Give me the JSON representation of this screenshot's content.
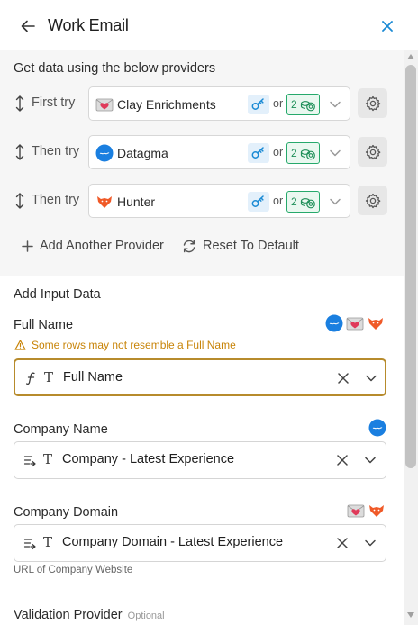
{
  "header": {
    "title": "Work Email"
  },
  "providers": {
    "heading": "Get data using the below providers",
    "rows": [
      {
        "label": "First try",
        "provider": "Clay Enrichments",
        "logo": "clay-envelope-icon",
        "or": "or",
        "credits": "2"
      },
      {
        "label": "Then try",
        "provider": "Datagma",
        "logo": "datagma-icon",
        "or": "or",
        "credits": "2"
      },
      {
        "label": "Then try",
        "provider": "Hunter",
        "logo": "hunter-fox-icon",
        "or": "or",
        "credits": "2"
      }
    ],
    "add_label": "Add Another Provider",
    "reset_label": "Reset To Default"
  },
  "inputs": {
    "heading": "Add Input Data",
    "full_name": {
      "label": "Full Name",
      "warning": "Some rows may not resemble a Full Name",
      "value": "Full Name",
      "lead_icon": "formula-icon"
    },
    "company_name": {
      "label": "Company Name",
      "value": "Company - Latest Experience",
      "lead_icon": "list-arrow-icon"
    },
    "company_domain": {
      "label": "Company Domain",
      "value": "Company Domain - Latest Experience",
      "hint": "URL of Company Website",
      "lead_icon": "list-arrow-icon"
    },
    "validation": {
      "label": "Validation Provider",
      "optional": "Optional"
    }
  },
  "colors": {
    "accent_blue": "#1a8ad4",
    "credit_green": "#26a96b",
    "warning": "#c88408",
    "focus_border": "#b78b2c"
  }
}
